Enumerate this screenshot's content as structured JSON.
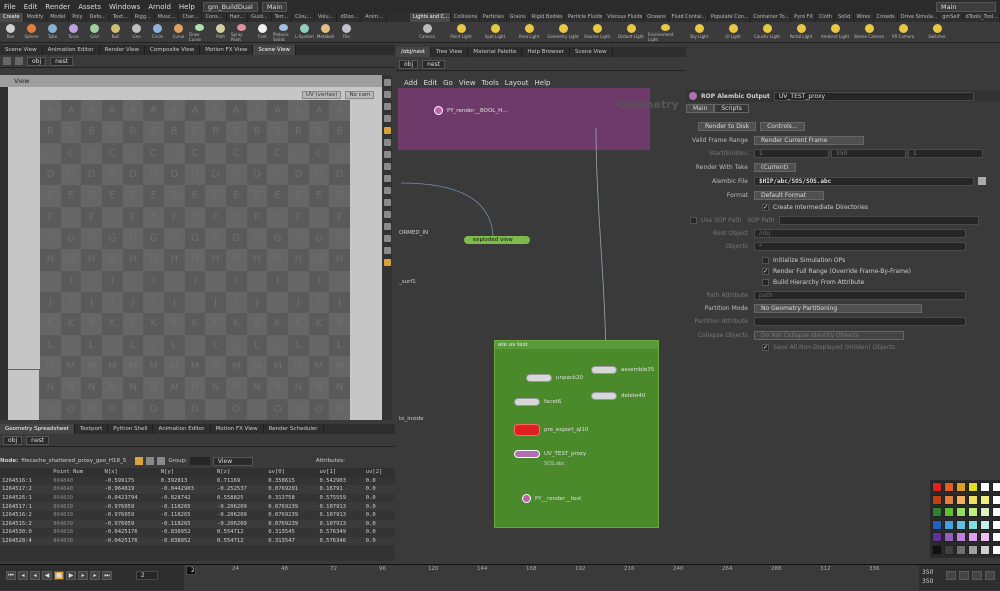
{
  "menubar": {
    "items": [
      "File",
      "Edit",
      "Render",
      "Assets",
      "Windows",
      "Arnold",
      "Help"
    ],
    "desktop": "gm_BuildDual",
    "context": "Main",
    "right_context": "Main"
  },
  "shelf_tabs_left": [
    "Create",
    "Modify",
    "Model",
    "Poly",
    "Defo...",
    "Text...",
    "Rigg...",
    "Musc...",
    "Char...",
    "Cons...",
    "Hair...",
    "Guid...",
    "Terr...",
    "Clou...",
    "Volu...",
    "dDoo...",
    "Anim..."
  ],
  "shelf_tools_left": [
    "Box",
    "Sphere",
    "Tube",
    "Torus",
    "Grid",
    "Null",
    "Line",
    "Circle",
    "Curve",
    "Draw Curve",
    "Path",
    "Spray Paint",
    "Font",
    "Platonic Solids",
    "L-System",
    "Metaball",
    "File"
  ],
  "shelf_tabs_right": [
    "Lights and C...",
    "Collisions",
    "Particles",
    "Grains",
    "Rigid Bodies",
    "Particle Fluids",
    "Viscous Fluids",
    "Oceans",
    "Fluid Contai...",
    "Populate Con...",
    "Container To...",
    "Pyro FX",
    "Cloth",
    "Solid",
    "Wires",
    "Crowds",
    "Drive Simula...",
    "gmSelf",
    "dTools_Tool..."
  ],
  "shelf_tools_right": [
    "Camera",
    "Point Light",
    "Spot Light",
    "Area Light",
    "Geometry Light",
    "Volume Light",
    "Distant Light",
    "Environment Light",
    "Sky Light",
    "GI Light",
    "Caustic Light",
    "Portal Light",
    "Ambient Light",
    "Stereo Camera",
    "VR Camera",
    "Switcher"
  ],
  "left_tabs": [
    "Scene View",
    "Animation Editor",
    "Render View",
    "Composite View",
    "Motion FX View",
    "Scene View"
  ],
  "viewport": {
    "path_obj": "obj",
    "path_net": "nest",
    "view_label": "View",
    "uv_dropdown": "UV (vertex)",
    "cam_dropdown": "No cam",
    "rows": [
      [
        "A",
        "A",
        "A",
        "A",
        "A",
        "A",
        "A",
        "A",
        "A",
        "A",
        "A",
        "A",
        "A",
        "A",
        "A"
      ],
      [
        "B",
        "B",
        "B",
        "B",
        "B",
        "B",
        "B",
        "B",
        "B",
        "B",
        "B",
        "B",
        "B",
        "B",
        "B"
      ],
      [
        "C",
        "C",
        "C",
        "C",
        "C",
        "C",
        "C",
        "C",
        "C",
        "C",
        "C",
        "C",
        "C",
        "C",
        "C"
      ],
      [
        "D",
        "D",
        "D",
        "D",
        "D",
        "D",
        "D",
        "D",
        "D",
        "D",
        "D",
        "D",
        "D",
        "D",
        "D"
      ],
      [
        "E",
        "E",
        "E",
        "E",
        "E",
        "E",
        "E",
        "E",
        "E",
        "E",
        "E",
        "E",
        "E",
        "E",
        "E"
      ],
      [
        "F",
        "F",
        "F",
        "F",
        "F",
        "F",
        "F",
        "F",
        "F",
        "F",
        "F",
        "F",
        "F",
        "F",
        "F"
      ],
      [
        "G",
        "G",
        "G",
        "G",
        "G",
        "G",
        "G",
        "G",
        "G",
        "G",
        "G",
        "G",
        "G",
        "G",
        "G"
      ],
      [
        "H",
        "H",
        "H",
        "H",
        "H",
        "H",
        "H",
        "H",
        "H",
        "H",
        "H",
        "H",
        "H",
        "H",
        "H"
      ],
      [
        "I",
        "I",
        "I",
        "I",
        "I",
        "I",
        "I",
        "I",
        "I",
        "I",
        "I",
        "I",
        "I",
        "I",
        "I"
      ],
      [
        "J",
        "J",
        "J",
        "J",
        "J",
        "J",
        "J",
        "J",
        "J",
        "J",
        "J",
        "J",
        "J",
        "J",
        "J"
      ],
      [
        "K",
        "K",
        "K",
        "K",
        "K",
        "K",
        "K",
        "K",
        "K",
        "K",
        "K",
        "K",
        "K",
        "K",
        "K"
      ],
      [
        "L",
        "L",
        "L",
        "L",
        "L",
        "L",
        "L",
        "L",
        "L",
        "L",
        "L",
        "L",
        "L",
        "L",
        "L"
      ],
      [
        "M",
        "M",
        "M",
        "M",
        "M",
        "M",
        "M",
        "M",
        "M",
        "M",
        "M",
        "M",
        "M",
        "M",
        "M"
      ],
      [
        "N",
        "N",
        "N",
        "N",
        "N",
        "N",
        "N",
        "N",
        "N",
        "N",
        "N",
        "N",
        "N",
        "N",
        "N"
      ],
      [
        "O",
        "O",
        "O",
        "O",
        "O",
        "O",
        "O",
        "O",
        "O",
        "O",
        "O",
        "O",
        "O",
        "O",
        "O"
      ]
    ]
  },
  "spreadsheet": {
    "tabs": [
      "Geometry Spreadsheet",
      "Textport",
      "Python Shell",
      "Animation Editor",
      "Motion FX View",
      "Render Scheduler"
    ],
    "path_obj": "obj",
    "path_net": "nest",
    "node_label": "Node:",
    "node_value": "filecache_shattered_proxy_geo_H18_5",
    "group_label": "Group:",
    "view_label": "View",
    "attributes_label": "Attributes:",
    "columns": [
      "",
      "Point Num",
      "N[x]",
      "N[y]",
      "N[z]",
      "uv[0]",
      "uv[1]",
      "uv[2]"
    ],
    "rows": [
      [
        "1264516:1",
        "804840",
        "-0.599175",
        "0.392813",
        "0.71169",
        "0.358615",
        "0.542903",
        "0.0"
      ],
      [
        "1264517:2",
        "804840",
        "-0.964819",
        "-0.0442903",
        "-0.252537",
        "0.0769201",
        "0.16791",
        "0.0"
      ],
      [
        "1264526:1",
        "804839",
        "-0.0423794",
        "-0.828742",
        "0.558825",
        "0.313758",
        "0.575559",
        "0.0"
      ],
      [
        "1264517:1",
        "804839",
        "-0.976059",
        "-0.118265",
        "-0.206209",
        "0.0769239",
        "0.107913",
        "0.0"
      ],
      [
        "1264516:2",
        "804839",
        "-0.976059",
        "-0.118265",
        "-0.206209",
        "0.0769239",
        "0.107913",
        "0.0"
      ],
      [
        "1264515:2",
        "804839",
        "-0.976059",
        "-0.118265",
        "-0.206209",
        "0.0769239",
        "0.107913",
        "0.0"
      ],
      [
        "1264530:0",
        "804838",
        "-0.0425176",
        "-0.838952",
        "0.554712",
        "0.313545",
        "0.576349",
        "0.0"
      ],
      [
        "1264528:4",
        "804838",
        "-0.0425176",
        "-0.838952",
        "0.554712",
        "0.313547",
        "0.576346",
        "0.0"
      ]
    ]
  },
  "network": {
    "tabs": [
      "/obj/nest",
      "Tree View",
      "Material Palette",
      "Help Browser",
      "Scene View"
    ],
    "path_obj": "obj",
    "path_net": "nest",
    "menu": [
      "Add",
      "Edit",
      "Go",
      "View",
      "Tools",
      "Layout",
      "Help"
    ],
    "geometry_label": "Geometry",
    "nodes": {
      "render_bool": "PY_render__BOOL_H...",
      "exploded": "exploded view",
      "ormed": "ORMED_IN",
      "surf": "_surf1",
      "to_inside": "to_inside",
      "box_title": "ate uv test",
      "unpack": "unpack20",
      "assemble": "assemble35",
      "delete": "delete40",
      "facet": "facet6",
      "pre_export": "pre_export_ql10",
      "uv_test": "UV_TEST_proxy",
      "uv_test_sub": "SOS.abc",
      "py_render": "PY__render__test"
    }
  },
  "params": {
    "node_type": "ROP Alembic Output",
    "node_name": "UV_TEST_proxy",
    "tabs": [
      "Main",
      "Scripts"
    ],
    "render_to_disk": "Render to Disk",
    "controls": "Controls...",
    "valid_frame_range_label": "Valid Frame Range",
    "valid_frame_range": "Render Current Frame",
    "start_end_label": "Start/End/Inc",
    "start_val": "1",
    "end_val": "350",
    "inc_val": "1",
    "render_with_take_label": "Render With Take",
    "render_with_take": "(Current)",
    "alembic_file_label": "Alembic File",
    "alembic_file": "$HIP/abc/SOS/SOS.abc",
    "format_label": "Format",
    "format": "Default Format",
    "create_intermediate": "Create Intermediate Directories",
    "use_sop_path": "Use SOP Path",
    "sop_path_label": "SOP Path",
    "root_object_label": "Root Object",
    "root_object": "/obj",
    "objects_label": "Objects",
    "objects": "*",
    "init_sim": "Initialize Simulation OPs",
    "render_full_range": "Render Full Range (Override Frame-By-Frame)",
    "build_hierarchy": "Build Hierarchy From Attribute",
    "path_attribute_label": "Path Attribute",
    "path_attribute": "path",
    "partition_mode_label": "Partition Mode",
    "partition_mode": "No Geometry Partitioning",
    "partition_attr_label": "Partition Attribute",
    "collapse_objects_label": "Collapse Objects",
    "collapse_objects": "Do Not Collapse Identity Objects",
    "save_all_non_displayed": "Save All Non-Displayed (Hidden) Objects"
  },
  "palette": {
    "colors": [
      "#e02020",
      "#e06020",
      "#e0a020",
      "#e0e020",
      "#ffffff",
      "#ffffff",
      "#c04010",
      "#e08040",
      "#f0b060",
      "#f0e060",
      "#f0f080",
      "#ffffff",
      "#308030",
      "#60c030",
      "#90e060",
      "#c0f080",
      "#e0f0c0",
      "#ffffff",
      "#2060c0",
      "#40a0e0",
      "#60c0e0",
      "#80e0e0",
      "#c0f0f0",
      "#ffffff",
      "#6030a0",
      "#9060c0",
      "#c080e0",
      "#e0a0f0",
      "#f0c0f0",
      "#ffffff",
      "#101010",
      "#404040",
      "#707070",
      "#a0a0a0",
      "#d0d0d0",
      "#ffffff"
    ]
  },
  "timeline": {
    "current_frame": "2",
    "frame_field": "2",
    "ticks": [
      "24",
      "48",
      "72",
      "96",
      "120",
      "144",
      "168",
      "192",
      "216",
      "240",
      "264",
      "288",
      "312",
      "336"
    ],
    "end_a": "350",
    "end_b": "350"
  }
}
